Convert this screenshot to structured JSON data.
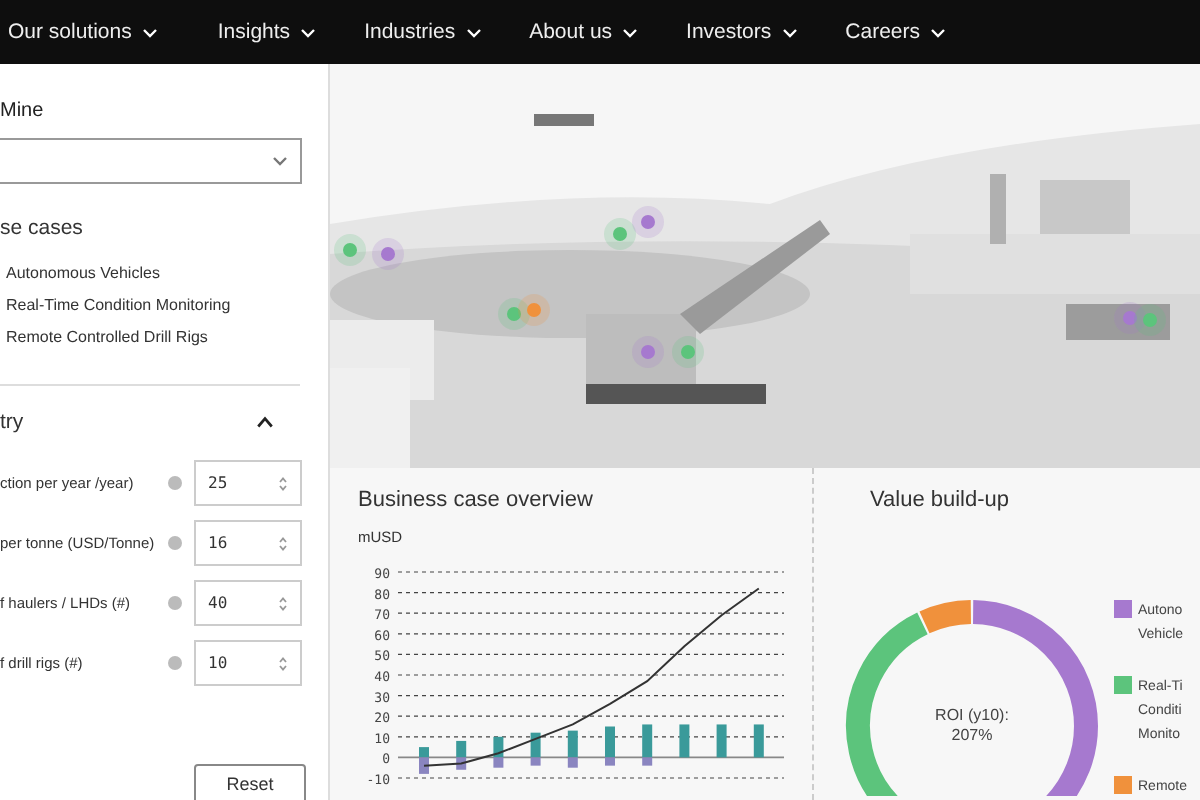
{
  "nav": [
    {
      "label": "Our solutions"
    },
    {
      "label": "Insights"
    },
    {
      "label": "Industries"
    },
    {
      "label": "About us"
    },
    {
      "label": "Investors"
    },
    {
      "label": "Careers"
    }
  ],
  "sidebar": {
    "mine_label": "Mine",
    "use_cases_title": "se cases",
    "use_cases": [
      {
        "label": "Autonomous Vehicles"
      },
      {
        "label": "Real-Time Condition Monitoring"
      },
      {
        "label": "Remote Controlled Drill Rigs"
      }
    ],
    "section_title": "try",
    "expanded": true,
    "inputs": [
      {
        "label": "ction per year /year)",
        "value": "25"
      },
      {
        "label": "per tonne (USD/Tonne)",
        "value": "16"
      },
      {
        "label": "f haulers / LHDs (#)",
        "value": "40"
      },
      {
        "label": "f drill rigs (#)",
        "value": "10"
      }
    ],
    "reset": "Reset"
  },
  "business_case": {
    "title": "Business case overview",
    "unit": "mUSD",
    "chart_data": {
      "type": "bar",
      "stacked": true,
      "grid": true,
      "ylim": [
        -10,
        90
      ],
      "yticks": [
        -10,
        0,
        10,
        20,
        30,
        40,
        50,
        60,
        70,
        80,
        90
      ],
      "series": [
        {
          "color": "#3a9a9a",
          "values": [
            5,
            8,
            10,
            12,
            13,
            15,
            16,
            16,
            16,
            16
          ]
        },
        {
          "color": "#8a85c0",
          "values": [
            -8,
            -6,
            -5,
            -4,
            -5,
            -4,
            -4,
            null,
            null,
            null
          ]
        },
        {
          "type": "line",
          "color": "#333333",
          "values": [
            -4,
            -3,
            2,
            9,
            16,
            26,
            37,
            54,
            69,
            82
          ]
        }
      ]
    }
  },
  "value_buildup": {
    "title": "Value build-up",
    "center_label": "ROI (y10):",
    "center_value": "207%",
    "legend": [
      {
        "label": "Autono Vehicle",
        "color": "#a679cf"
      },
      {
        "label": "Real-Ti Conditi Monito",
        "color": "#5cc47c"
      },
      {
        "label": "Remote",
        "color": "#f0913c"
      }
    ]
  }
}
